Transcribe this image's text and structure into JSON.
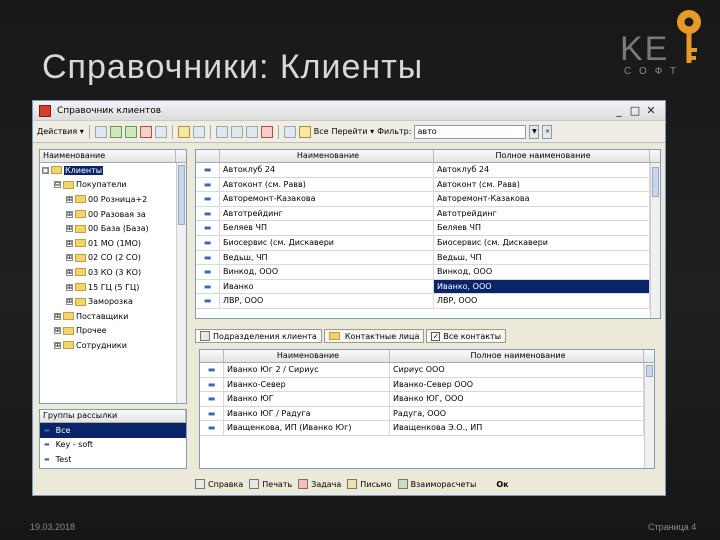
{
  "slide": {
    "title": "Справочники: Клиенты",
    "logo_main": "KE",
    "logo_sub": "СОФТ",
    "date": "19.03.2018",
    "page": "Страница 4"
  },
  "window": {
    "title": "Справочник клиентов",
    "btn_min": "_",
    "btn_max": "□",
    "btn_close": "✕"
  },
  "toolbar": {
    "actions": "Действия ▾",
    "all": "Все",
    "goto": "Перейти ▾",
    "filter_label": "Фильтр:",
    "filter_value": "авто"
  },
  "tree": {
    "header": "Наименование",
    "items": [
      {
        "label": "Клиенты",
        "level": 0,
        "expander": "□",
        "selected": true
      },
      {
        "label": "Покупатели",
        "level": 1,
        "expander": "⊟",
        "selected": false
      },
      {
        "label": "00 Розница+2",
        "level": 2,
        "expander": "⊞",
        "selected": false
      },
      {
        "label": "00 Разовая за",
        "level": 2,
        "expander": "⊞",
        "selected": false
      },
      {
        "label": "00 База (База)",
        "level": 2,
        "expander": "⊞",
        "selected": false
      },
      {
        "label": "01 МО (1МО)",
        "level": 2,
        "expander": "⊞",
        "selected": false
      },
      {
        "label": "02 СО (2 СО)",
        "level": 2,
        "expander": "⊞",
        "selected": false
      },
      {
        "label": "03 КО (3 КО)",
        "level": 2,
        "expander": "⊞",
        "selected": false
      },
      {
        "label": "15 ГЦ (5 ГЦ)",
        "level": 2,
        "expander": "⊞",
        "selected": false
      },
      {
        "label": "Заморозка",
        "level": 2,
        "expander": "⊞",
        "selected": false
      },
      {
        "label": "Поставщики",
        "level": 1,
        "expander": "⊞",
        "selected": false
      },
      {
        "label": "Прочее",
        "level": 1,
        "expander": "⊞",
        "selected": false
      },
      {
        "label": "Сотрудники",
        "level": 1,
        "expander": "⊞",
        "selected": false
      }
    ]
  },
  "groups": {
    "header": "Группы рассылки",
    "items": [
      {
        "label": "Все",
        "selected": true
      },
      {
        "label": "Key - soft",
        "selected": false
      },
      {
        "label": "Test",
        "selected": false
      }
    ]
  },
  "clients": {
    "columns": [
      "Наименование",
      "Полное наименование"
    ],
    "rows": [
      {
        "name": "Автоклуб 24",
        "full": "Автоклуб 24",
        "selected": false
      },
      {
        "name": "Автоконт (см. Равв)",
        "full": "Автоконт (см. Равв)",
        "selected": false
      },
      {
        "name": "Авторемонт-Казакова",
        "full": "Авторемонт-Казакова",
        "selected": false
      },
      {
        "name": "Автотрейдинг",
        "full": "Автотрейдинг",
        "selected": false
      },
      {
        "name": "Беляев ЧП",
        "full": "Беляев ЧП",
        "selected": false
      },
      {
        "name": "Биосервис (см. Дискавери",
        "full": "Биосервис (см. Дискавери",
        "selected": false
      },
      {
        "name": "Ведьш, ЧП",
        "full": "Ведьш, ЧП",
        "selected": false
      },
      {
        "name": "Винкод, ООО",
        "full": "Винкод, ООО",
        "selected": false
      },
      {
        "name": "Иванко",
        "full": "Иванко, ООО",
        "selected": true
      },
      {
        "name": "ЛВР, ООО",
        "full": "ЛВР, ООО",
        "selected": false
      }
    ]
  },
  "tabs": {
    "subdivisions": "Подразделения клиента",
    "contacts": "Контактные лица",
    "all_contacts": "Все контакты"
  },
  "subdivisions": {
    "columns": [
      "Наименование",
      "Полное наименование"
    ],
    "rows": [
      {
        "name": "Иванко Юг 2 / Сириус",
        "full": "Сириус ООО"
      },
      {
        "name": "Иванко-Север",
        "full": "Иванко-Север ООО"
      },
      {
        "name": "Иванко ЮГ",
        "full": "Иванко ЮГ, ООО"
      },
      {
        "name": "Иванко ЮГ / Радуга",
        "full": "Радуга, ООО"
      },
      {
        "name": "Иващенкова, ИП (Иванко Юг)",
        "full": "Иващенкова Э.О., ИП"
      }
    ]
  },
  "bottom": {
    "help": "Справка",
    "print": "Печать",
    "task": "Задача",
    "letter": "Письмо",
    "settlements": "Взаиморасчеты",
    "ok": "Ок"
  }
}
